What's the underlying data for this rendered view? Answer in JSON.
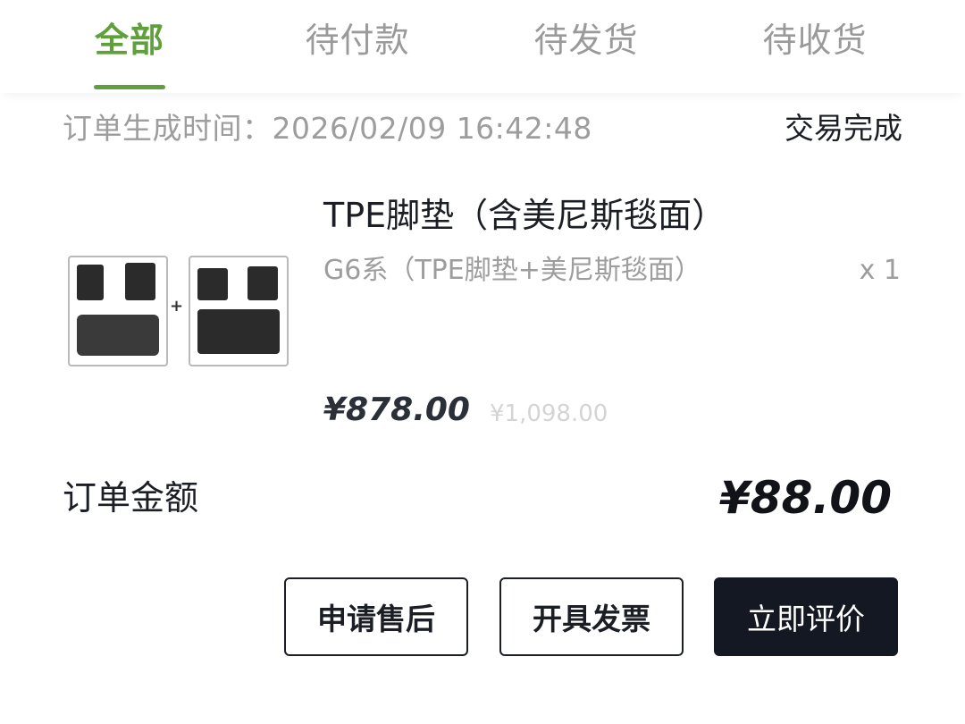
{
  "tabs": [
    {
      "label": "全部",
      "active": true
    },
    {
      "label": "待付款",
      "active": false
    },
    {
      "label": "待发货",
      "active": false
    },
    {
      "label": "待收货",
      "active": false
    }
  ],
  "order": {
    "time_label": "订单生成时间：",
    "time_value": "2026/02/09 16:42:48",
    "status": "交易完成"
  },
  "product": {
    "title": "TPE脚垫（含美尼斯毯面）",
    "variant": "G6系（TPE脚垫+美尼斯毯面）",
    "quantity": "x 1",
    "price": "¥878.00",
    "original_price": "¥1,098.00",
    "image_plus": "+"
  },
  "summary": {
    "amount_label": "订单金额",
    "amount_value": "¥88.00"
  },
  "actions": {
    "aftersale": "申请售后",
    "invoice": "开具发票",
    "review": "立即评价"
  },
  "colors": {
    "accent": "#5fa03c",
    "primary_button": "#141823",
    "muted_text": "#9d9d9d"
  }
}
